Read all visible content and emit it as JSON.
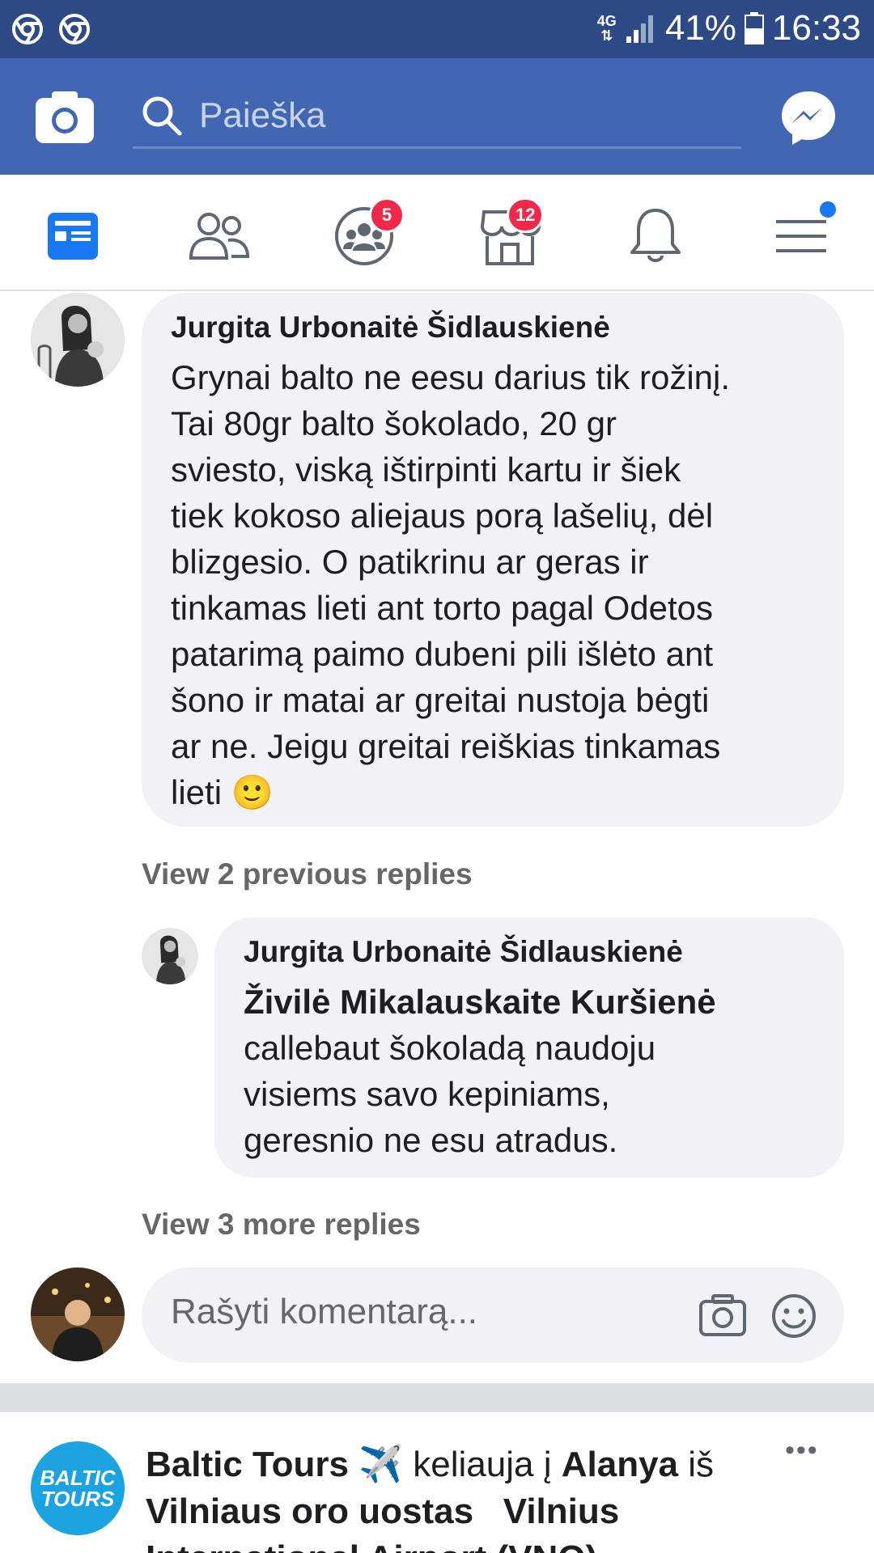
{
  "status_bar": {
    "network": "4G",
    "battery": "41%",
    "time": "16:33"
  },
  "header": {
    "search_placeholder": "Paieška",
    "icons": [
      "camera-icon",
      "search-icon",
      "messenger-icon"
    ]
  },
  "nav": {
    "items": [
      {
        "name": "news-feed",
        "icon": "news-feed-icon",
        "active": true
      },
      {
        "name": "friends",
        "icon": "friends-icon"
      },
      {
        "name": "groups",
        "icon": "groups-icon",
        "badge": "5"
      },
      {
        "name": "marketplace",
        "icon": "marketplace-icon",
        "badge": "12"
      },
      {
        "name": "notifications",
        "icon": "bell-icon"
      },
      {
        "name": "menu",
        "icon": "menu-icon",
        "dot": true
      }
    ],
    "accent": "#1877f2",
    "badge_color": "#f02849"
  },
  "comment": {
    "author": "Jurgita Urbonaitė Šidlauskienė",
    "lines": [
      "Grynai balto ne eesu darius tik rožinį.",
      "Tai 80gr balto šokolado, 20 gr",
      "sviesto, viską ištirpinti kartu ir  šiek",
      "tiek kokoso aliejaus porą lašelių, dėl",
      "blizgesio.  O patikrinu ar geras ir",
      "tinkamas lieti ant torto  pagal Odetos",
      "patarimą paimo dubeni pili išlėto ant",
      "šono ir matai ar greitai nustoja bėgti",
      "ar ne. Jeigu greitai reiškias tinkamas",
      "lieti"
    ],
    "emoji": "🙂"
  },
  "view_previous": "View 2 previous replies",
  "reply": {
    "author": "Jurgita Urbonaitė Šidlauskienė",
    "mention": "Živilė Mikalauskaite Kuršienė",
    "lines": [
      "callebaut  šokoladą naudoju",
      "visiems  savo kepiniams,",
      "geresnio ne esu atradus."
    ]
  },
  "view_more": "View 3 more replies",
  "composer": {
    "placeholder": "Rašyti komentarą...",
    "icons": [
      "camera-icon",
      "emoji-icon"
    ]
  },
  "post": {
    "page_name": "Baltic Tours",
    "avatar_line1": "BALTIC",
    "avatar_line2": "TOURS",
    "plane_emoji": "✈️",
    "verb": "keliauja į",
    "destination": "Alanya",
    "from_word": "iš",
    "origin": "Vilniaus oro uostas",
    "origin_extra": "Vilnius International Airport (VNO)",
    "more": "•••"
  }
}
